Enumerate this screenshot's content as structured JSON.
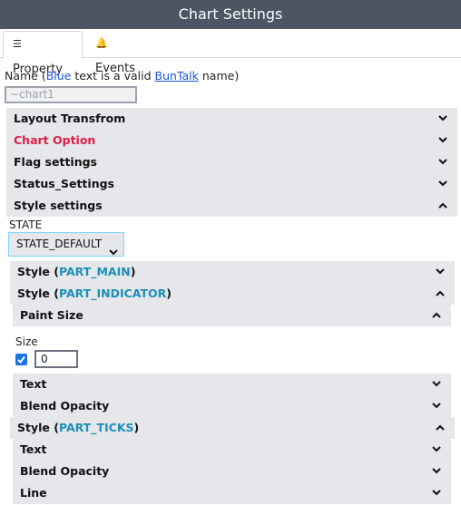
{
  "window": {
    "title": "Chart Settings"
  },
  "tabs": [
    {
      "label": "Property",
      "icon": "list-icon"
    },
    {
      "label": "Events",
      "icon": "bell-icon"
    }
  ],
  "name_field": {
    "label_prefix": "Name (",
    "label_blue": "Blue",
    "label_mid": " text is a valid ",
    "label_link": "BunTalk",
    "label_suffix": " name)",
    "value": "~chart1"
  },
  "sections": {
    "layout_transform": "Layout Transfrom",
    "chart_option": "Chart Option",
    "flag_settings": "Flag settings",
    "status_settings": "Status_Settings",
    "style_settings": "Style settings"
  },
  "state": {
    "label": "STATE",
    "selected": "STATE_DEFAULT"
  },
  "style_main": {
    "prefix": "Style (",
    "part": "PART_MAIN",
    "suffix": ")"
  },
  "style_indicator": {
    "prefix": "Style (",
    "part": "PART_INDICATOR",
    "suffix": ")"
  },
  "paint_size": {
    "label": "Paint Size",
    "size_label": "Size",
    "checked": true,
    "value": "0"
  },
  "indicator_items": {
    "text": "Text",
    "blend_opacity": "Blend Opacity"
  },
  "style_ticks": {
    "prefix": "Style (",
    "part": "PART_TICKS",
    "suffix": ")"
  },
  "ticks_items": {
    "text": "Text",
    "blend_opacity": "Blend Opacity",
    "line": "Line"
  },
  "colors": {
    "titlebar": "#4b5563",
    "part_label": "#1b8fb5",
    "chart_option": "#e11d48",
    "link": "#1a56db"
  }
}
